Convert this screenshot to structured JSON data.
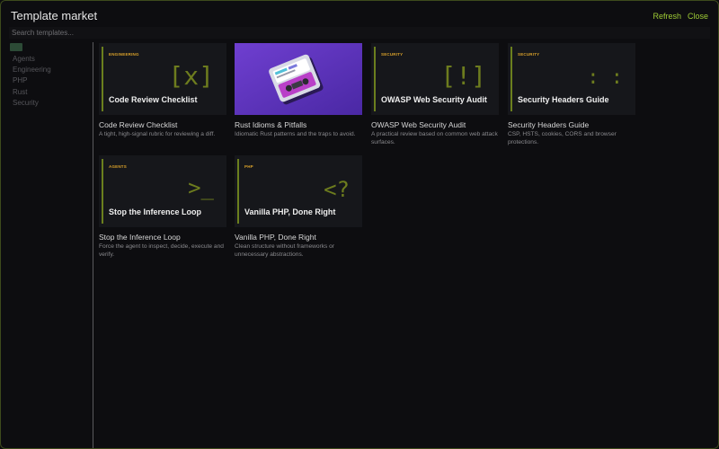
{
  "window": {
    "title": "Template market",
    "actions": {
      "refresh": "Refresh",
      "close": "Close"
    },
    "accent_color": "#9ecb35"
  },
  "search": {
    "placeholder": "Search templates...",
    "value": ""
  },
  "sidebar": {
    "categories": [
      "Agents",
      "Engineering",
      "PHP",
      "Rust",
      "Security"
    ]
  },
  "templates": [
    {
      "tag": "ENGINEERING",
      "glyph": "[x]",
      "thumb_title": "Code Review Checklist",
      "name": "Code Review Checklist",
      "description": "A tight, high-signal rubric for reviewing a diff."
    },
    {
      "tag": "",
      "glyph": "",
      "thumb_title": "",
      "name": "Rust Idioms & Pitfalls",
      "description": "Idiomatic Rust patterns and the traps to avoid.",
      "thumb_image": "cassette-illustration"
    },
    {
      "tag": "SECURITY",
      "glyph": "[!]",
      "thumb_title": "OWASP Web Security Audit",
      "name": "OWASP Web Security Audit",
      "description": "A practical review based on common web attack surfaces."
    },
    {
      "tag": "SECURITY",
      "glyph": ": :",
      "thumb_title": "Security Headers Guide",
      "name": "Security Headers Guide",
      "description": "CSP, HSTS, cookies, CORS and browser protections."
    },
    {
      "tag": "AGENTS",
      "glyph": ">_",
      "thumb_title": "Stop the Inference Loop",
      "name": "Stop the Inference Loop",
      "description": "Force the agent to inspect, decide, execute and verify."
    },
    {
      "tag": "PHP",
      "glyph": "<?",
      "thumb_title": "Vanilla PHP, Done Right",
      "name": "Vanilla PHP, Done Right",
      "description": "Clean structure without frameworks or unnecessary abstractions."
    }
  ]
}
